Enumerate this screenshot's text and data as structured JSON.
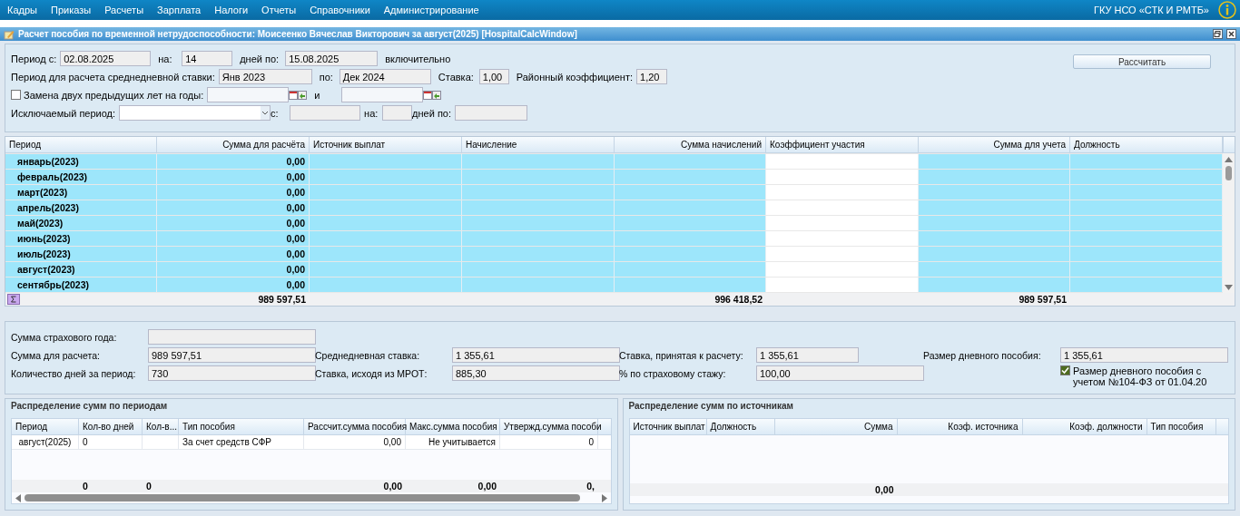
{
  "menu": {
    "items": [
      "Кадры",
      "Приказы",
      "Расчеты",
      "Зарплата",
      "Налоги",
      "Отчеты",
      "Справочники",
      "Администрирование"
    ],
    "organization": "ГКУ НСО «СТК И РМТБ»"
  },
  "window": {
    "title": "Расчет пособия по временной нетрудоспособности: Моисеенко Вячеслав Викторович за август(2025) [HospitalCalcWindow]"
  },
  "form": {
    "period_from": {
      "label": "Период с:",
      "value": "02.08.2025"
    },
    "days": {
      "label": "на:",
      "value": "14"
    },
    "period_to": {
      "label": "дней по:",
      "value": "15.08.2025"
    },
    "inclusive": "включительно",
    "calc_button": "Рассчитать",
    "avg_from": {
      "label": "Период для расчета среднедневной ставки:",
      "value": "Янв 2023"
    },
    "avg_to": {
      "label": "по:",
      "value": "Дек 2024"
    },
    "rate": {
      "label": "Ставка:",
      "value": "1,00"
    },
    "regional": {
      "label": "Районный коэффициент:",
      "value": "1,20"
    },
    "replace_years": {
      "label": "Замена двух предыдущих лет на годы:",
      "checked": false
    },
    "replace_and": "и",
    "excluded": {
      "label": "Исключаемый период:",
      "from_label": "с:",
      "days_label": "на:",
      "to_label": "дней по:"
    }
  },
  "main_grid": {
    "columns": [
      "Период",
      "Сумма для расчёта",
      "Источник выплат",
      "Начисление",
      "Сумма начислений",
      "Коэффициент участия",
      "Сумма для учета",
      "Должность"
    ],
    "rows": [
      {
        "period": "январь(2023)",
        "amount": "0,00"
      },
      {
        "period": "февраль(2023)",
        "amount": "0,00"
      },
      {
        "period": "март(2023)",
        "amount": "0,00"
      },
      {
        "period": "апрель(2023)",
        "amount": "0,00"
      },
      {
        "period": "май(2023)",
        "amount": "0,00"
      },
      {
        "period": "июнь(2023)",
        "amount": "0,00"
      },
      {
        "period": "июль(2023)",
        "amount": "0,00"
      },
      {
        "period": "август(2023)",
        "amount": "0,00"
      },
      {
        "period": "сентябрь(2023)",
        "amount": "0,00"
      }
    ],
    "totals": {
      "amount": "989 597,51",
      "accrued": "996 418,52",
      "accounted": "989 597,51"
    }
  },
  "summary": {
    "columns": [
      [
        {
          "kind": "field",
          "label": "Сумма страхового года:"
        },
        {
          "kind": "field",
          "label": "Сумма для расчета:",
          "value": "989 597,51"
        },
        {
          "kind": "field",
          "label": "Количество дней за период:",
          "value": "730"
        }
      ],
      [
        {
          "kind": "field",
          "label": "Среднедневная ставка:",
          "value": "1 355,61"
        },
        {
          "kind": "field",
          "label": "Ставка, исходя из МРОТ:",
          "value": "885,30"
        }
      ],
      [
        {
          "kind": "field",
          "label": "Ставка, принятая к расчету:",
          "value": "1 355,61"
        },
        {
          "kind": "field",
          "label": "% по страховому стажу:",
          "value": "100,00"
        }
      ],
      [
        {
          "kind": "field",
          "label": "Размер дневного пособия:",
          "value": "1 355,61"
        },
        {
          "kind": "checkbox",
          "label": "Размер дневного пособия с учетом №104-ФЗ от 01.04.20",
          "checked": true
        }
      ]
    ]
  },
  "periods_panel": {
    "title": "Распределение сумм по периодам",
    "columns": [
      "Период",
      "Кол-во дней",
      "Кол-в...",
      "Тип пособия",
      "Рассчит.сумма пособия",
      "Макс.сумма пособия",
      "Утвержд.сумма пособи"
    ],
    "rows": [
      {
        "period": "август(2025)",
        "days": "0",
        "benefit_type": "За счет средств СФР",
        "calculated": "0,00",
        "max": "Не учитывается",
        "approved": "0"
      }
    ],
    "totals": {
      "days": "0",
      "column_3": "0",
      "calculated": "0,00",
      "max": "0,00",
      "approved": "0,"
    }
  },
  "sources_panel": {
    "title": "Распределение сумм по источникам",
    "columns": [
      "Источник выплат",
      "Должность",
      "Сумма",
      "Коэф. источника",
      "Коэф. должности",
      "Тип пособия"
    ],
    "totals": {
      "amount": "0,00"
    }
  }
}
